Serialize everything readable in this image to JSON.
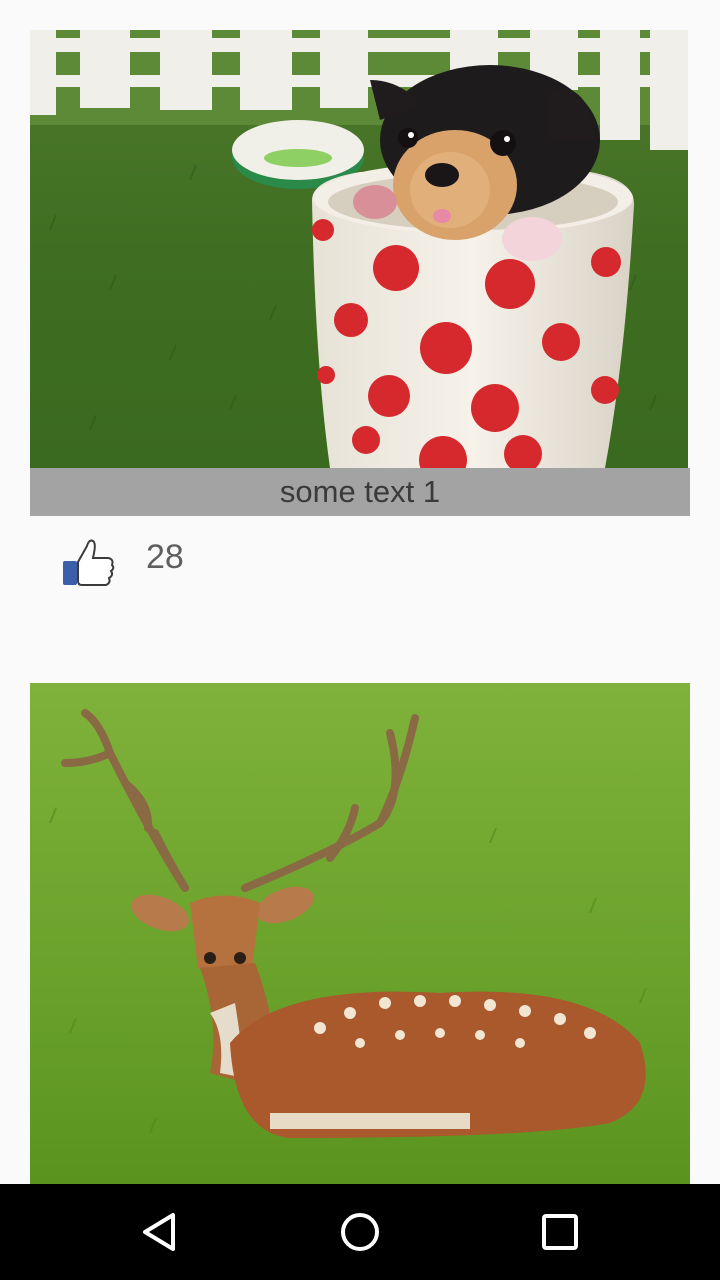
{
  "feed": {
    "posts": [
      {
        "image_subject": "puppy-in-polka-dot-cup",
        "caption": "some text 1",
        "likes": "28",
        "like_icon": "thumbs-up-icon"
      },
      {
        "image_subject": "fallow-deer-lying-in-grass"
      }
    ]
  },
  "navbar": {
    "buttons": [
      {
        "icon": "back-triangle-icon"
      },
      {
        "icon": "home-circle-icon"
      },
      {
        "icon": "recents-square-icon"
      }
    ]
  },
  "colors": {
    "background": "#fafafa",
    "caption_bar": "#a3a3a3",
    "caption_text": "#3a3a3a",
    "like_blue": "#3b5fa8",
    "navbar": "#000000"
  }
}
